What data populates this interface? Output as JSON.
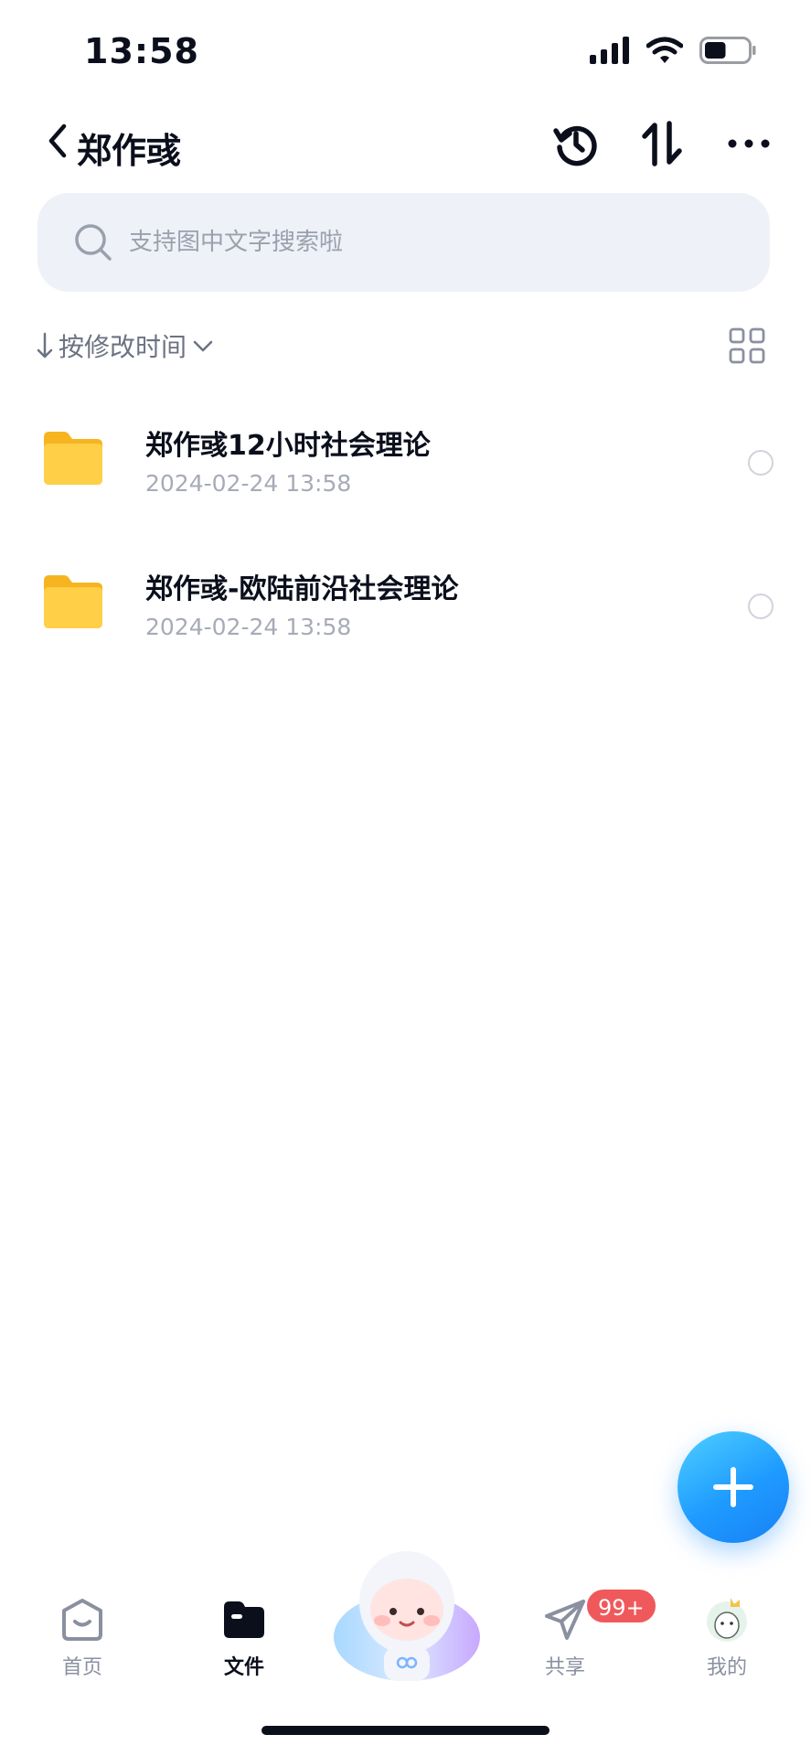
{
  "status_bar": {
    "time": "13:58",
    "battery_level": 0.5
  },
  "header": {
    "title": "郑作彧"
  },
  "search": {
    "placeholder": "支持图中文字搜索啦"
  },
  "sort": {
    "label": "按修改时间"
  },
  "files": [
    {
      "name": "郑作彧12小时社会理论",
      "date": "2024-02-24 13:58"
    },
    {
      "name": "郑作彧-欧陆前沿社会理论",
      "date": "2024-02-24 13:58"
    }
  ],
  "tabbar": {
    "items": [
      {
        "label": "首页"
      },
      {
        "label": "文件"
      },
      {
        "label": "共享"
      },
      {
        "label": "我的"
      }
    ],
    "share_badge": "99+"
  },
  "colors": {
    "accent": "#1e9bff",
    "folder": "#ffc93c",
    "badge": "#f0595c",
    "search_bg": "#eef1f7"
  }
}
